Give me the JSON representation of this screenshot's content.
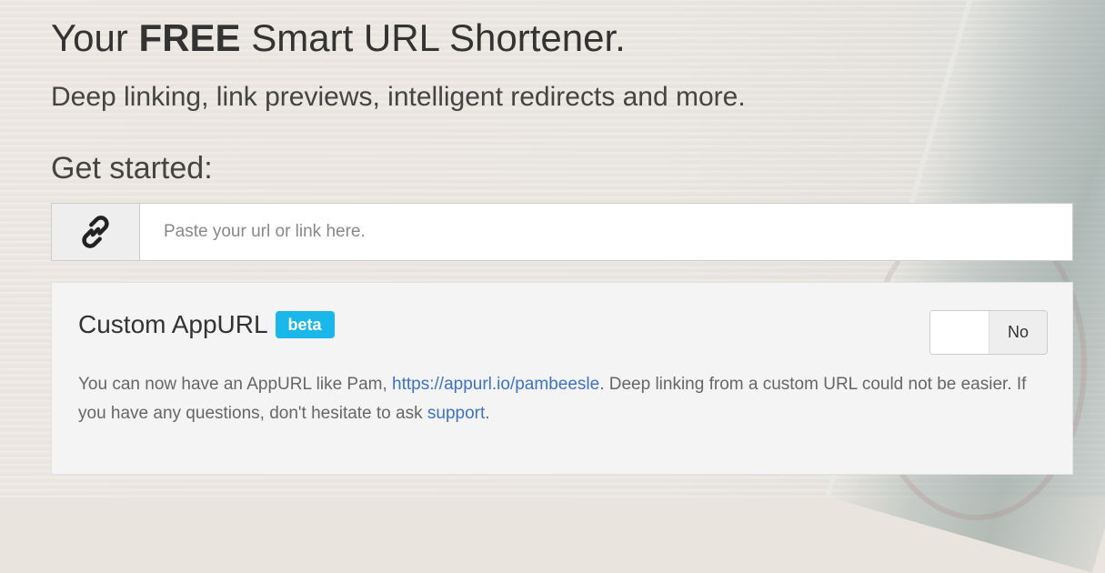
{
  "hero": {
    "title_prefix": "Your",
    "title_bold": "FREE",
    "title_suffix": "Smart URL Shortener.",
    "subtitle": "Deep linking, link previews, intelligent redirects and more.",
    "get_started": "Get started:"
  },
  "url_form": {
    "icon": "link-icon",
    "placeholder": "Paste your url or link here."
  },
  "custom_appurl": {
    "title": "Custom AppURL",
    "badge": "beta",
    "toggle_label": "No",
    "desc_part1": "You can now have an AppURL like Pam,",
    "example_link": "https://appurl.io/pambeesle",
    "desc_part2": ". Deep linking from a custom URL could not be easier. If you have any questions, don't hesitate to ask",
    "support_link": "support",
    "desc_part3": "."
  },
  "colors": {
    "badge": "#1ab7ea",
    "link": "#3d72c4"
  }
}
